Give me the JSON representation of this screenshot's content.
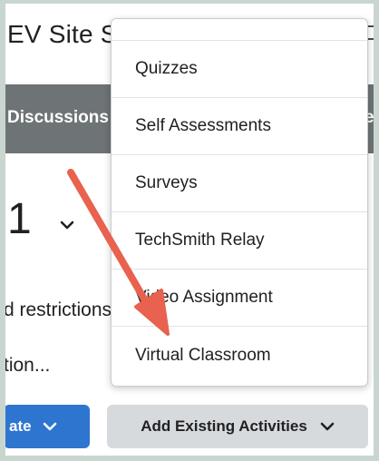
{
  "header": {
    "title": "EV Site S"
  },
  "navbar": {
    "left_item": "Discussions",
    "right_item": "es"
  },
  "content": {
    "unit_number": "1",
    "restrictions": "d restrictions",
    "description": "tion..."
  },
  "buttons": {
    "create_label": "ate",
    "add_existing_label": "Add Existing Activities"
  },
  "dropdown": {
    "items": [
      "Quizzes",
      "Self Assessments",
      "Surveys",
      "TechSmith Relay",
      "Video Assignment",
      "Virtual Classroom"
    ]
  },
  "colors": {
    "navbar": "#6e7376",
    "primary_button": "#2e75d0",
    "secondary_button": "#d7dadd",
    "annotation_arrow": "#e8624f",
    "frame": "#c9d6d0"
  },
  "icons": {
    "grid": "grid-icon",
    "message": "message-icon",
    "chevron": "chevron-down-icon",
    "arrow": "annotation-arrow"
  }
}
